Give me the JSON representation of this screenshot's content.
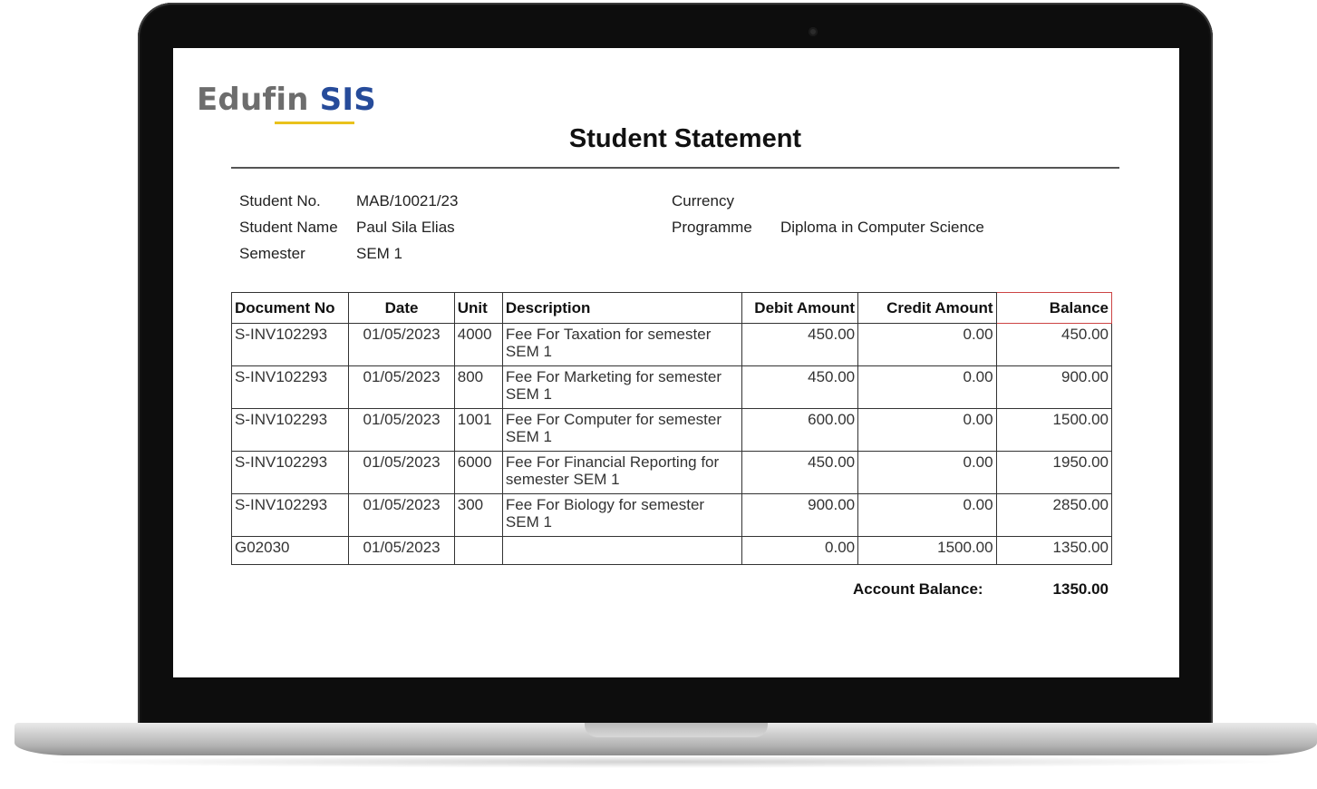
{
  "brand": {
    "part1": "Edufin",
    "part2": "SIS"
  },
  "title": "Student Statement",
  "student": {
    "no_label": "Student No.",
    "no_value": "MAB/10021/23",
    "name_label": "Student Name",
    "name_value": "Paul Sila Elias",
    "semester_label": "Semester",
    "semester_value": "SEM 1",
    "currency_label": "Currency",
    "currency_value": "",
    "programme_label": "Programme",
    "programme_value": "Diploma in Computer Science"
  },
  "table": {
    "headers": [
      "Document No",
      "Date",
      "Unit",
      "Description",
      "Debit Amount",
      "Credit Amount",
      "Balance"
    ],
    "rows": [
      [
        "S-INV102293",
        "01/05/2023",
        "4000",
        "Fee For Taxation for semester SEM 1",
        "450.00",
        "0.00",
        "450.00"
      ],
      [
        "S-INV102293",
        "01/05/2023",
        "800",
        "Fee For Marketing for semester SEM 1",
        "450.00",
        "0.00",
        "900.00"
      ],
      [
        "S-INV102293",
        "01/05/2023",
        "1001",
        "Fee For Computer for semester SEM 1",
        "600.00",
        "0.00",
        "1500.00"
      ],
      [
        "S-INV102293",
        "01/05/2023",
        "6000",
        "Fee For Financial Reporting for semester SEM 1",
        "450.00",
        "0.00",
        "1950.00"
      ],
      [
        "S-INV102293",
        "01/05/2023",
        "300",
        "Fee For Biology for semester SEM 1",
        "900.00",
        "0.00",
        "2850.00"
      ],
      [
        "G02030",
        "01/05/2023",
        "",
        "",
        "0.00",
        "1500.00",
        "1350.00"
      ]
    ]
  },
  "account_balance": {
    "label": "Account Balance:",
    "value": "1350.00"
  },
  "colors": {
    "brand_grey": "#6d6d6d",
    "brand_blue": "#264b9a",
    "brand_underline": "#e9c21c"
  }
}
